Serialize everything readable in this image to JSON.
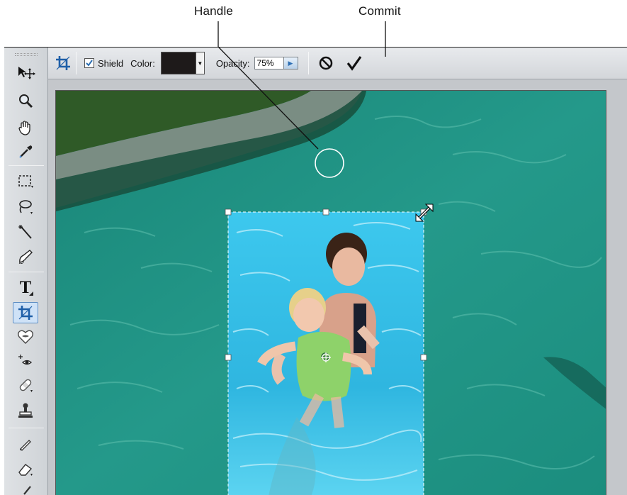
{
  "callouts": {
    "handle_label": "Handle",
    "commit_label": "Commit"
  },
  "options_bar": {
    "crop_tool_icon": "crop-icon",
    "shield_checked": true,
    "shield_label": "Shield",
    "color_label": "Color:",
    "shield_color": "#1e1a1a",
    "opacity_label": "Opacity:",
    "opacity_value": "75%",
    "cancel_icon": "cancel-icon",
    "commit_icon": "checkmark-icon"
  },
  "toolbox": {
    "tools": [
      {
        "name": "move-tool",
        "icon": "move-icon"
      },
      {
        "name": "zoom-tool",
        "icon": "magnifier-icon"
      },
      {
        "name": "hand-tool",
        "icon": "hand-icon"
      },
      {
        "name": "eyedropper-tool",
        "icon": "eyedropper-icon"
      },
      {
        "name": "marquee-tool",
        "icon": "marquee-icon"
      },
      {
        "name": "lasso-tool",
        "icon": "lasso-icon"
      },
      {
        "name": "magic-wand-tool",
        "icon": "magic-wand-icon"
      },
      {
        "name": "quick-selection-tool",
        "icon": "quick-selection-icon"
      },
      {
        "name": "type-tool",
        "icon": "type-icon",
        "label": "T"
      },
      {
        "name": "crop-tool",
        "icon": "crop-icon",
        "active": true
      },
      {
        "name": "red-eye-tool",
        "icon": "red-eye-icon"
      },
      {
        "name": "spot-healing-tool",
        "icon": "spot-healing-icon"
      },
      {
        "name": "bandage-tool",
        "icon": "bandage-icon"
      },
      {
        "name": "clone-stamp-tool",
        "icon": "stamp-icon"
      },
      {
        "name": "pencil-tool",
        "icon": "pencil-icon"
      },
      {
        "name": "eraser-tool",
        "icon": "eraser-icon"
      },
      {
        "name": "brush-tool",
        "icon": "brush-icon"
      }
    ]
  },
  "colors": {
    "pool_water": "#1f8d7e",
    "crop_area_water": "#35c2e8",
    "active_tool_highlight": "#cfe2f7"
  }
}
